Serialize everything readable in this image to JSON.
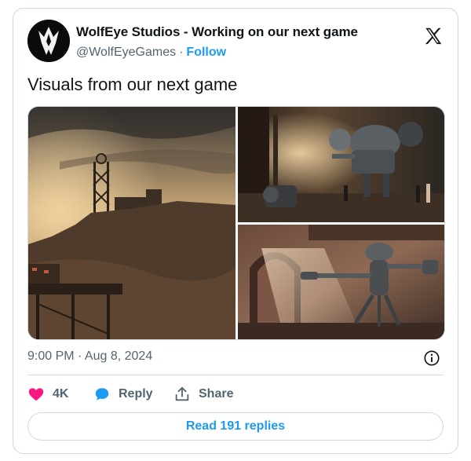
{
  "author": {
    "display_name": "WolfEye Studios - Working on our next game",
    "handle": "@WolfEyeGames",
    "separator": "·",
    "follow_label": "Follow"
  },
  "tweet": {
    "text": "Visuals from our next game",
    "timestamp": "9:00 PM · Aug 8, 2024"
  },
  "actions": {
    "like_count": "4K",
    "reply_label": "Reply",
    "share_label": "Share"
  },
  "read_replies_label": "Read 191 replies",
  "icons": [
    "wolf-logo-avatar",
    "x-logo-icon",
    "info-icon",
    "heart-icon",
    "reply-bubble-icon",
    "share-icon"
  ],
  "colors": {
    "accent": "#1d9bf0",
    "like": "#f91880",
    "muted": "#536471",
    "border": "#cfd9de"
  }
}
